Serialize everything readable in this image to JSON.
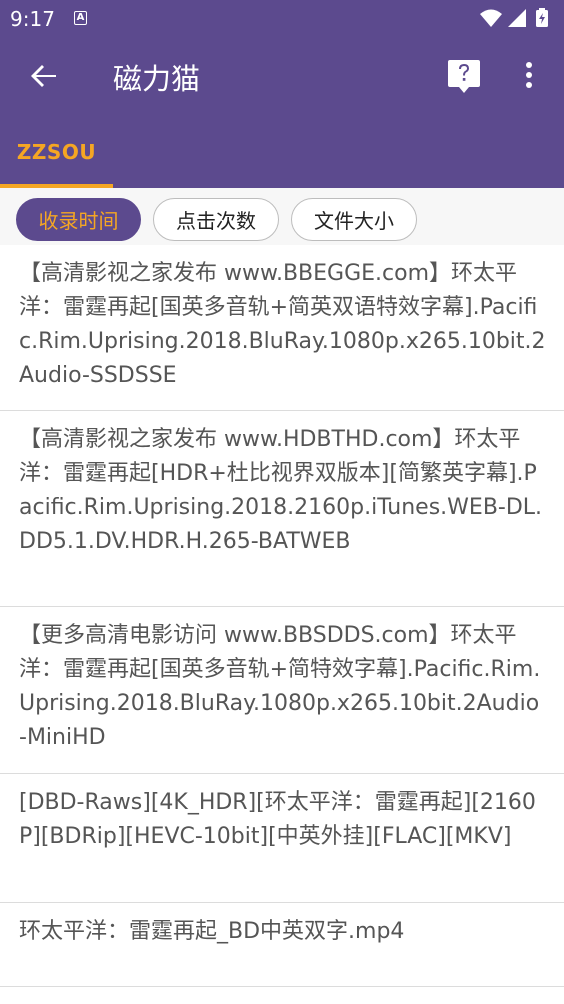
{
  "status": {
    "time": "9:17",
    "notif_letter": "A"
  },
  "app": {
    "title": "磁力猫"
  },
  "tabs": [
    {
      "label": "ZZSOU"
    }
  ],
  "sort": {
    "chips": [
      "收录时间",
      "点击次数",
      "文件大小"
    ]
  },
  "results": [
    {
      "name": "【高清影视之家发布 www.BBEGGE.com】环太平洋：雷霆再起[国英多音轨+简英双语特效字幕].Pacific.Rim.Uprising.2018.BluRay.1080p.x265.10bit.2Audio-SSDSSE"
    },
    {
      "name": "【高清影视之家发布 www.HDBTHD.com】环太平洋：雷霆再起[HDR+杜比视界双版本][简繁英字幕].Pacific.Rim.Uprising.2018.2160p.iTunes.WEB-DL.DD5.1.DV.HDR.H.265-BATWEB"
    },
    {
      "name": "【更多高清电影访问 www.BBSDDS.com】环太平洋：雷霆再起[国英多音轨+简特效字幕].Pacific.Rim.Uprising.2018.BluRay.1080p.x265.10bit.2Audio-MiniHD"
    },
    {
      "name": "[DBD-Raws][4K_HDR][环太平洋：雷霆再起][2160P][BDRip][HEVC-10bit][中英外挂][FLAC][MKV]"
    },
    {
      "name": "环太平洋：雷霆再起_BD中英双字.mp4"
    }
  ],
  "colors": {
    "primary": "#5c4a8e",
    "accent": "#f5a623"
  }
}
